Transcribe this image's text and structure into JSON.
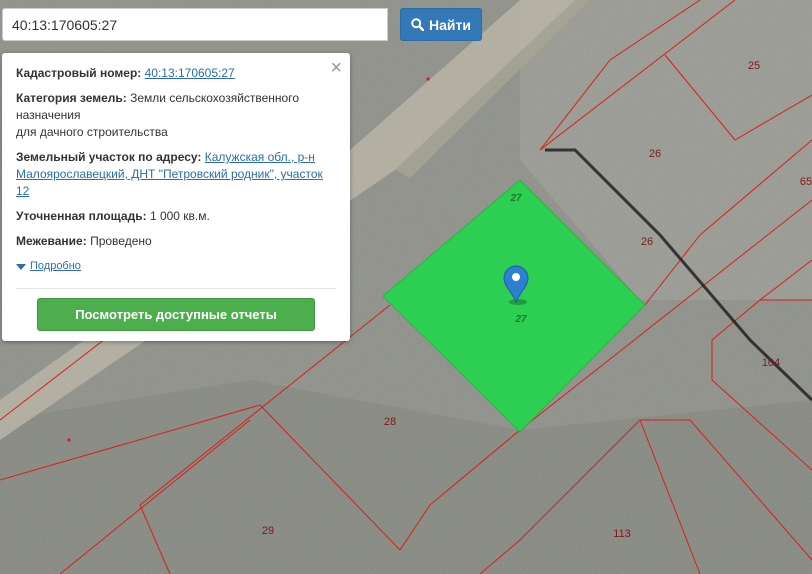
{
  "search": {
    "value": "40:13:170605:27",
    "button_label": "Найти"
  },
  "panel": {
    "cadastral_label": "Кадастровый номер:",
    "cadastral_value": "40:13:170605:27",
    "category_label": "Категория земель:",
    "category_value_line1": "Земли сельскохозяйственного назначения",
    "category_value_line2": "для дачного строительства",
    "address_label": "Земельный участок по адресу:",
    "address_value": "Калужская обл., р-н Малоярославецкий, ДНТ \"Петровский родник\", участок 12",
    "area_label": "Уточненная площадь:",
    "area_value": "1 000 кв.м.",
    "survey_label": "Межевание:",
    "survey_value": "Проведено",
    "more_label": "Подробно",
    "report_button": "Посмотреть доступные отчеты",
    "close_symbol": "×"
  },
  "map": {
    "parcel_labels": [
      "25",
      "26",
      "26",
      "65",
      "27",
      "27",
      "104",
      "28",
      "29",
      "113"
    ],
    "parcel_color": "#27d34f",
    "boundary_color": "#d81e1e",
    "marker_color": "#2c7fd1",
    "marker_icon": "map-pin-icon"
  }
}
